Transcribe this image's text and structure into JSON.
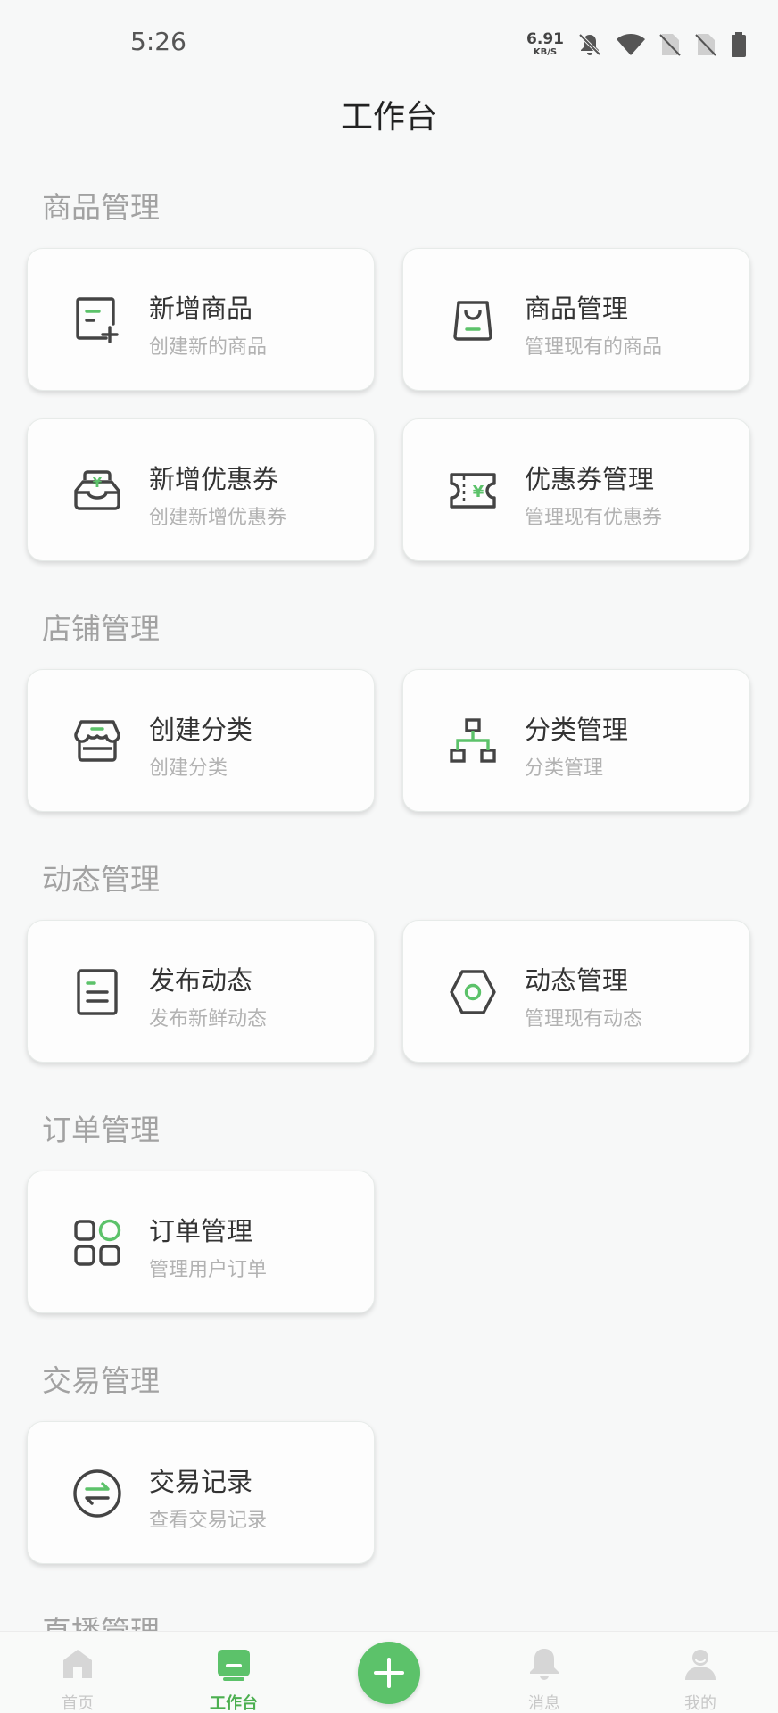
{
  "status_bar": {
    "time": "5:26",
    "net_speed_value": "6.91",
    "net_speed_unit": "KB/S",
    "icons": [
      "bell-off-icon",
      "wifi-icon",
      "no-sim-icon",
      "no-sim-icon",
      "battery-icon"
    ]
  },
  "page": {
    "title": "工作台"
  },
  "sections": [
    {
      "title": "商品管理",
      "cards": [
        {
          "title": "新增商品",
          "subtitle": "创建新的商品",
          "icon": "add-product-icon"
        },
        {
          "title": "商品管理",
          "subtitle": "管理现有的商品",
          "icon": "shopping-bag-icon"
        },
        {
          "title": "新增优惠券",
          "subtitle": "创建新增优惠券",
          "icon": "coupon-add-icon"
        },
        {
          "title": "优惠券管理",
          "subtitle": "管理现有优惠券",
          "icon": "coupon-ticket-icon"
        }
      ]
    },
    {
      "title": "店铺管理",
      "cards": [
        {
          "title": "创建分类",
          "subtitle": "创建分类",
          "icon": "store-icon"
        },
        {
          "title": "分类管理",
          "subtitle": "分类管理",
          "icon": "hierarchy-icon"
        }
      ]
    },
    {
      "title": "动态管理",
      "cards": [
        {
          "title": "发布动态",
          "subtitle": "发布新鲜动态",
          "icon": "document-icon"
        },
        {
          "title": "动态管理",
          "subtitle": "管理现有动态",
          "icon": "hexagon-icon"
        }
      ]
    },
    {
      "title": "订单管理",
      "cards": [
        {
          "title": "订单管理",
          "subtitle": "管理用户订单",
          "icon": "grid-apps-icon"
        }
      ]
    },
    {
      "title": "交易管理",
      "cards": [
        {
          "title": "交易记录",
          "subtitle": "查看交易记录",
          "icon": "exchange-icon"
        }
      ]
    },
    {
      "title": "直播管理",
      "cards": []
    }
  ],
  "tab_bar": {
    "tabs": [
      {
        "label": "首页",
        "icon": "home-icon",
        "active": false
      },
      {
        "label": "工作台",
        "icon": "workbench-icon",
        "active": true
      },
      {
        "label": "消息",
        "icon": "bell-icon",
        "active": false
      },
      {
        "label": "我的",
        "icon": "user-icon",
        "active": false
      }
    ],
    "center_button_icon": "plus-icon"
  },
  "colors": {
    "accent": "#5cc26a",
    "icon_dark": "#444444",
    "section_title": "#a2a2a2"
  }
}
